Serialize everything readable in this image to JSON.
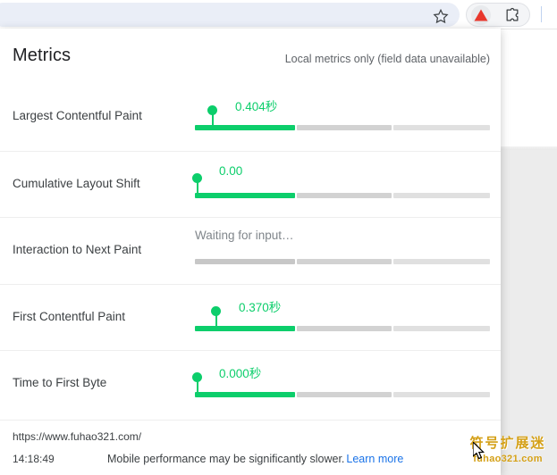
{
  "browser": {
    "omnibox_value": "",
    "icons": {
      "bookmark": "star-icon",
      "web_vitals_extension": "red-triangle-icon",
      "extensions": "puzzle-piece-icon"
    }
  },
  "popup": {
    "title": "Metrics",
    "subtitle": "Local metrics only (field data unavailable)",
    "colors": {
      "good": "#0cce6b",
      "track_good": "#c7c7c7",
      "track_ni": "#d2d2d2",
      "track_poor": "#e0e0e0",
      "link": "#1a73e8",
      "text": "#3c4043",
      "muted": "#5f6368"
    },
    "metrics": [
      {
        "label": "Largest Contentful Paint",
        "value": "0.404秒",
        "rating": "good",
        "filled": true,
        "marker_pct": 5.8
      },
      {
        "label": "Cumulative Layout Shift",
        "value": "0.00",
        "rating": "good",
        "filled": true,
        "marker_pct": 0.0
      },
      {
        "label": "Interaction to Next Paint",
        "value": "Waiting for input…",
        "rating": "pending",
        "filled": false,
        "marker_pct": null
      },
      {
        "label": "First Contentful Paint",
        "value": "0.370秒",
        "rating": "good",
        "filled": true,
        "marker_pct": 7.0
      },
      {
        "label": "Time to First Byte",
        "value": "0.000秒",
        "rating": "good",
        "filled": true,
        "marker_pct": 0.0
      }
    ],
    "footer": {
      "url": "https://www.fuhao321.com/",
      "time": "14:18:49",
      "note": "Mobile performance may be significantly slower.",
      "link_label": "Learn more"
    }
  },
  "watermark": {
    "cn": "符号扩展迷",
    "url": "fuhao321.com"
  }
}
